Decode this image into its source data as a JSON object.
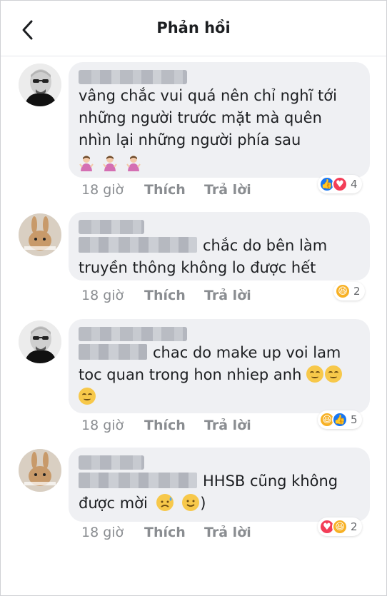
{
  "header": {
    "title": "Phản hồi"
  },
  "comments": [
    {
      "text": "vâng chắc vui quá nên chỉ nghĩ tới những người trước mặt mà quên nhìn lại những người phía sau",
      "line1": "vâng chắc vui quá nên chỉ nghĩ tới",
      "line2": "những người trước mặt mà quên",
      "line3": "nhìn lại những người phía sau",
      "emoji_line": [
        "person-shrugging",
        "person-shrugging",
        "person-shrugging"
      ],
      "time": "18 giờ",
      "like": "Thích",
      "reply": "Trả lời",
      "reactions": [
        "like",
        "love"
      ],
      "reaction_count": "4"
    },
    {
      "line1": "chắc do bên làm",
      "line2": "truyền thông không lo được hết",
      "time": "18 giờ",
      "like": "Thích",
      "reply": "Trả lời",
      "reactions": [
        "haha"
      ],
      "reaction_count": "2"
    },
    {
      "line1": "chac do make up voi lam",
      "line2": "toc quan trong hon nhiep anh",
      "time": "18 giờ",
      "like": "Thích",
      "reply": "Trả lời",
      "reactions": [
        "haha",
        "like"
      ],
      "reaction_count": "5"
    },
    {
      "line1": "HHSB cũng không",
      "line2": "được mời",
      "line2_suffix": ")",
      "time": "18 giờ",
      "like": "Thích",
      "reply": "Trả lời",
      "reactions": [
        "love",
        "haha"
      ],
      "reaction_count": "2"
    }
  ],
  "icons": {
    "back": "chevron-left-icon",
    "like": "thumbs-up-icon",
    "love": "heart-icon",
    "haha": "laughing-face-icon"
  },
  "colors": {
    "bubble": "#eff0f3",
    "meta": "#8a8d91",
    "like": "#1877f2",
    "love": "#f33e58",
    "haha": "#f7b125"
  }
}
